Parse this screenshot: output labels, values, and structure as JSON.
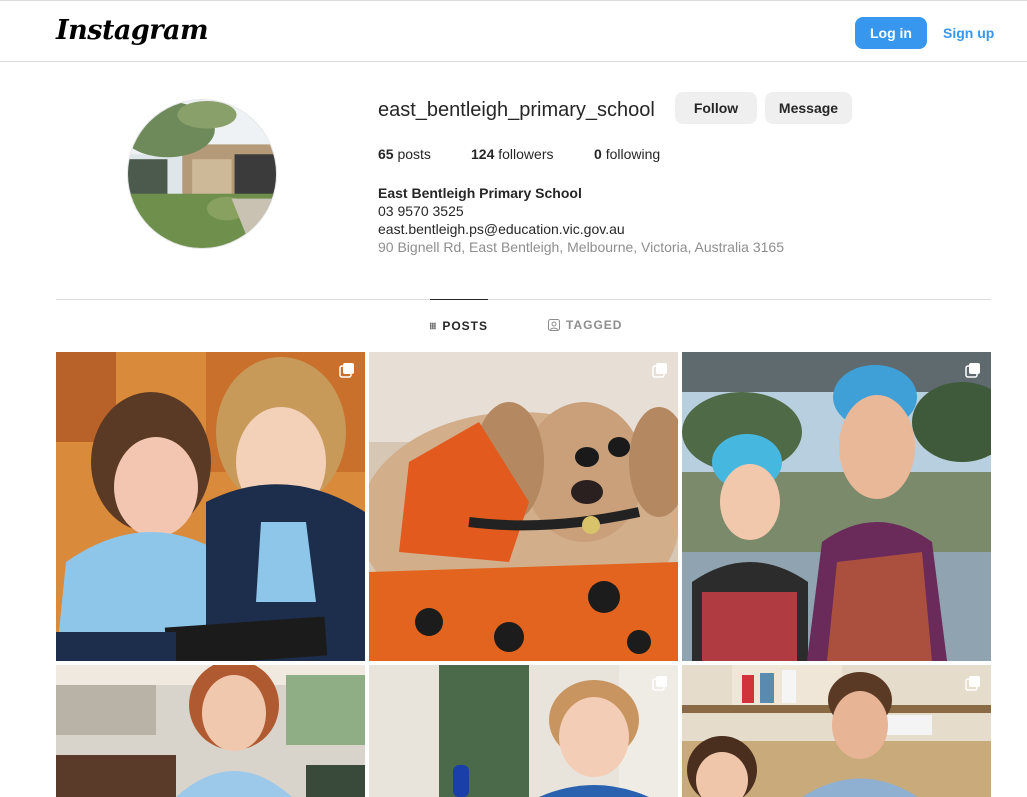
{
  "header": {
    "logo_text": "Instagram",
    "login_label": "Log in",
    "signup_label": "Sign up",
    "accent_color": "#3797ef"
  },
  "profile": {
    "username": "east_bentleigh_primary_school",
    "follow_label": "Follow",
    "message_label": "Message",
    "stats": {
      "posts_count": "65",
      "posts_label": "posts",
      "followers_count": "124",
      "followers_label": "followers",
      "following_count": "0",
      "following_label": "following"
    },
    "bio": {
      "name": "East Bentleigh Primary School",
      "phone": "03 9570 3525",
      "email": "east.bentleigh.ps@education.vic.gov.au",
      "address": "90 Bignell Rd, East Bentleigh, Melbourne, Victoria, Australia 3165"
    }
  },
  "tabs": {
    "posts_label": "POSTS",
    "tagged_label": "TAGGED"
  },
  "grid": {
    "posts": [
      {
        "icon": "multi-post-icon",
        "subject": "two students reading"
      },
      {
        "icon": "multi-post-icon",
        "subject": "therapy dog"
      },
      {
        "icon": "multi-post-icon",
        "subject": "students in swim caps"
      },
      {
        "icon": "",
        "subject": "student portrait"
      },
      {
        "icon": "multi-post-icon",
        "subject": "young student"
      },
      {
        "icon": "multi-post-icon",
        "subject": "students in kitchen"
      }
    ]
  }
}
